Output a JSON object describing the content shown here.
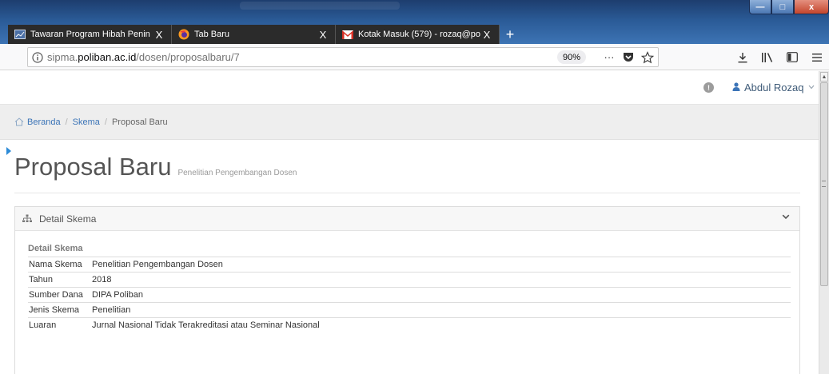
{
  "browser": {
    "tabs": [
      {
        "label": "Tawaran Program Hibah Penin",
        "active": true
      },
      {
        "label": "Tab Baru",
        "active": false
      },
      {
        "label": "Kotak Masuk (579) - rozaq@po",
        "active": false
      }
    ],
    "new_tab_symbol": "+",
    "close_symbol": "X",
    "url": {
      "prefix": "sipma.",
      "domain": "poliban.ac.id",
      "path": "/dosen/proposalbaru/7"
    },
    "zoom": "90%",
    "page_actions_symbol": "···",
    "window_controls": {
      "minimize": "—",
      "maximize": "□",
      "close": "x"
    }
  },
  "header": {
    "notification_symbol": "!",
    "user_name": "Abdul Rozaq",
    "caret": "⌵"
  },
  "breadcrumb": {
    "items": [
      "Beranda",
      "Skema",
      "Proposal Baru"
    ],
    "separator": "/"
  },
  "page": {
    "title": "Proposal Baru",
    "subtitle": "Penelitian Pengembangan Dosen"
  },
  "panel": {
    "heading": "Detail Skema",
    "section_label": "Detail Skema",
    "rows": [
      {
        "key": "Nama Skema",
        "value": "Penelitian Pengembangan Dosen"
      },
      {
        "key": "Tahun",
        "value": "2018"
      },
      {
        "key": "Sumber Dana",
        "value": "DIPA Poliban"
      },
      {
        "key": "Jenis Skema",
        "value": "Penelitian"
      },
      {
        "key": "Luaran",
        "value": "Jurnal Nasional Tidak Terakreditasi atau Seminar Nasional"
      }
    ]
  },
  "colors": {
    "link": "#3b74b7",
    "tab_background": "#2b2b2b",
    "titlebar": "#2a5a96",
    "marker": "#2d8bd7"
  }
}
